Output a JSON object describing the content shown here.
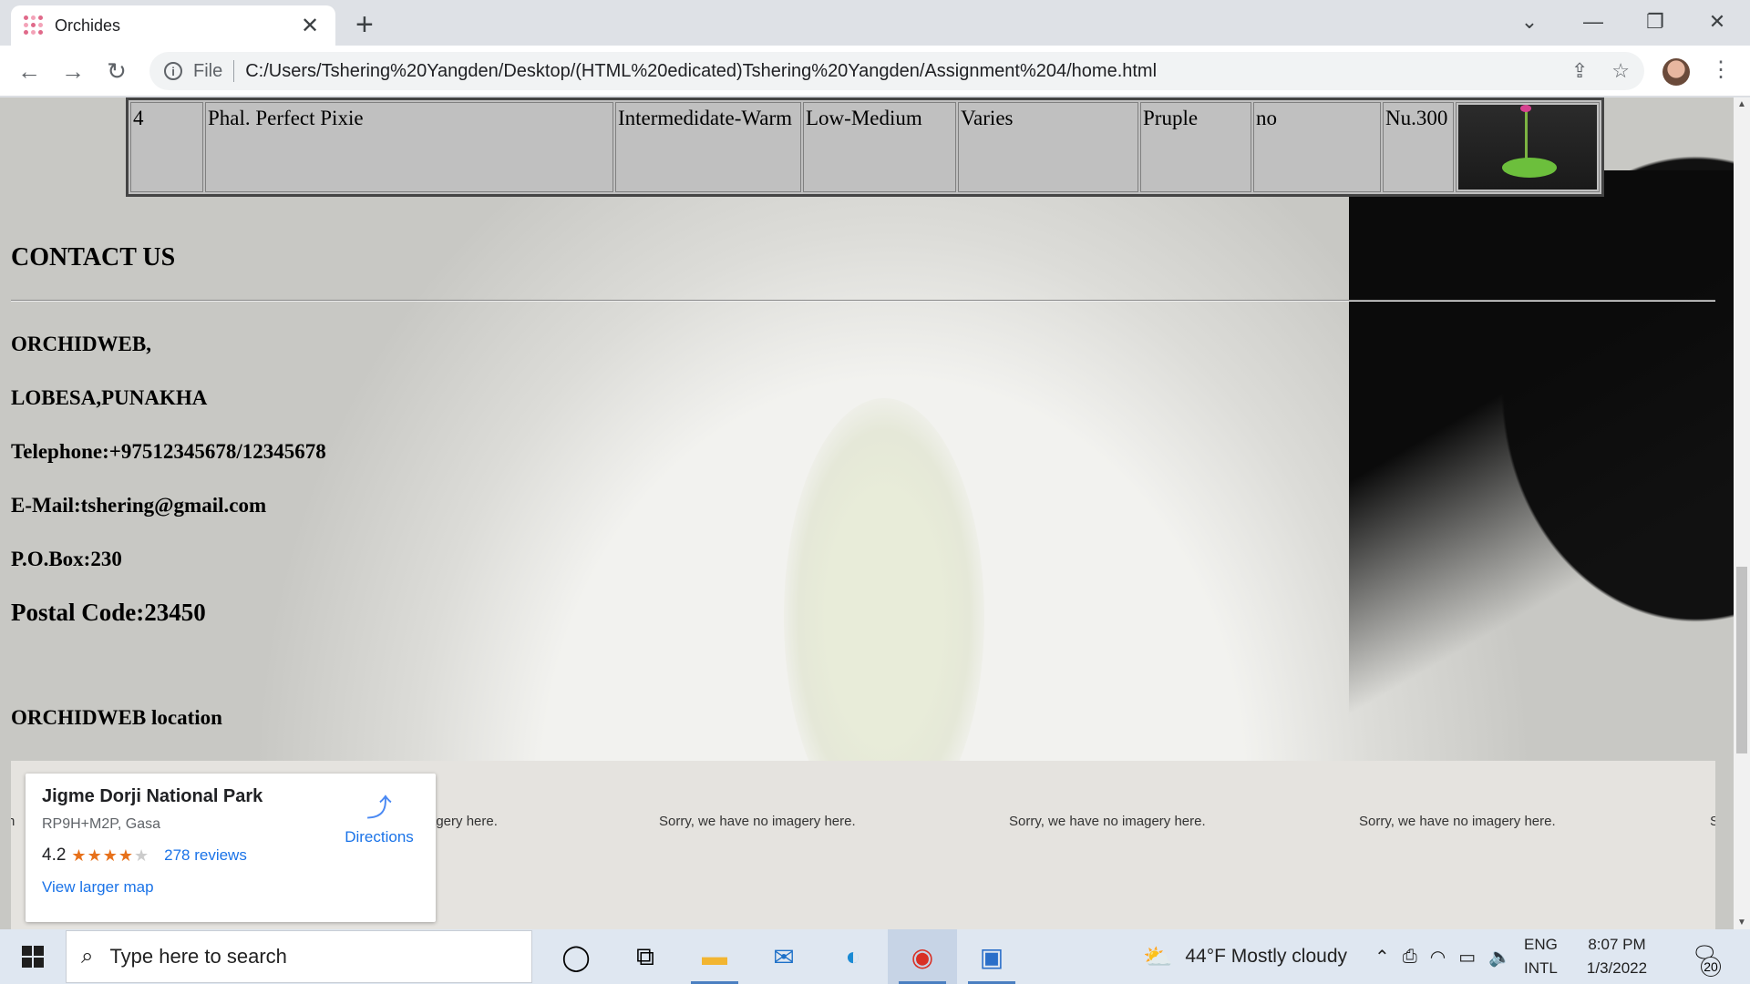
{
  "browser": {
    "tab_title": "Orchides",
    "scheme_label": "File",
    "url": "C:/Users/Tshering%20Yangden/Desktop/(HTML%20edicated)Tshering%20Yangden/Assignment%204/home.html"
  },
  "table_row": {
    "cells": [
      "4",
      "Phal. Perfect Pixie",
      "Intermedidate-Warm",
      "Low-Medium",
      "Varies",
      "Pruple",
      "no",
      "Nu.300"
    ]
  },
  "contact": {
    "heading": "CONTACT US",
    "lines": [
      "ORCHIDWEB,",
      "LOBESA,PUNAKHA",
      "Telephone:+97512345678/12345678",
      "E-Mail:tshering@gmail.com",
      "P.O.Box:230"
    ],
    "postal": "Postal Code:23450",
    "location_heading": "ORCHIDWEB location"
  },
  "map": {
    "place_name": "Jigme Dorji National Park",
    "address": "RP9H+M2P, Gasa",
    "rating": "4.2",
    "stars_filled": 4,
    "reviews": "278 reviews",
    "larger_map": "View larger map",
    "directions": "Directions",
    "no_imagery": [
      "h",
      "agery here.",
      "Sorry, we have no imagery here.",
      "Sorry, we have no imagery here.",
      "Sorry, we have no imagery here.",
      "S"
    ]
  },
  "taskbar": {
    "search_placeholder": "Type here to search",
    "weather": "44°F  Mostly cloudy",
    "lang_top": "ENG",
    "lang_bottom": "INTL",
    "time": "8:07 PM",
    "date": "1/3/2022",
    "notification_count": "20"
  },
  "colors": {
    "link": "#1a73e8",
    "star": "#e7711b",
    "table_bg": "#c0c0c0"
  }
}
